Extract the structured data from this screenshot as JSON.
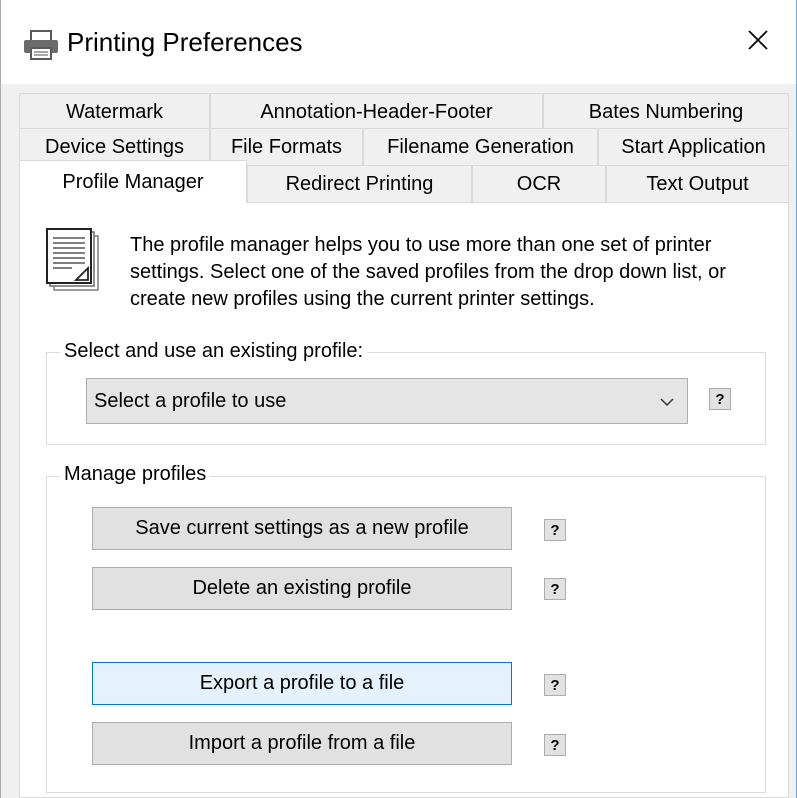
{
  "window": {
    "title": "Printing Preferences",
    "close_icon": "close-icon",
    "printer_icon": "printer-icon"
  },
  "tabs": {
    "row1": [
      {
        "label": "Watermark"
      },
      {
        "label": "Annotation-Header-Footer"
      },
      {
        "label": "Bates Numbering"
      }
    ],
    "row2": [
      {
        "label": "Device Settings"
      },
      {
        "label": "File Formats"
      },
      {
        "label": "Filename Generation"
      },
      {
        "label": "Start Application"
      }
    ],
    "row3": [
      {
        "label": "Profile Manager",
        "active": true
      },
      {
        "label": "Redirect Printing"
      },
      {
        "label": "OCR"
      },
      {
        "label": "Text Output"
      }
    ]
  },
  "panel": {
    "intro_lines": [
      "The profile manager helps you to use more than one set of printer",
      "settings. Select one of the saved profiles from the drop down list, or",
      "create new profiles using the current printer settings."
    ],
    "doc_icon": "document-icon",
    "select_group": {
      "label": "Select and use an existing profile:",
      "combo_value": "Select a profile to use",
      "help": "?"
    },
    "manage_group": {
      "label": "Manage profiles",
      "buttons": [
        {
          "label": "Save current settings as a new profile",
          "help": "?"
        },
        {
          "label": "Delete an existing profile",
          "help": "?"
        },
        {
          "label": "Export a profile to a file",
          "help": "?",
          "focused": true
        },
        {
          "label": "Import a profile from a file",
          "help": "?"
        }
      ]
    }
  },
  "colors": {
    "dialog_bg": "#f0f0f0",
    "panel_bg": "#ffffff",
    "button_bg": "#e1e1e1",
    "focused_button_bg": "#e5f1fb",
    "focused_button_border": "#0078d7"
  }
}
